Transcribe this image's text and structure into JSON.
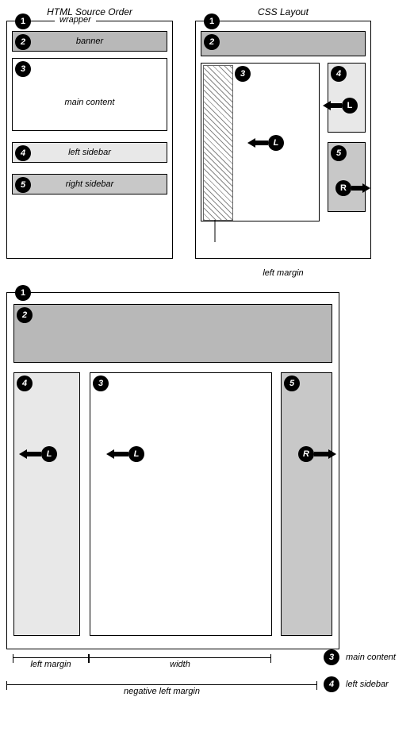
{
  "titles": {
    "html_source": "HTML Source Order",
    "css_layout": "CSS Layout"
  },
  "badges": {
    "n1": "1",
    "n2": "2",
    "n3": "3",
    "n4": "4",
    "n5": "5",
    "L": "L",
    "R": "R"
  },
  "labels": {
    "wrapper": "wrapper",
    "banner": "banner",
    "main_content": "main content",
    "left_sidebar": "left sidebar",
    "right_sidebar": "right sidebar",
    "left_margin": "left margin",
    "width": "width",
    "negative_left_margin": "negative left margin"
  },
  "trail": {
    "row1": {
      "badge": "3",
      "label": "main content"
    },
    "row2": {
      "badge": "4",
      "label": "left sidebar"
    }
  },
  "diagram": {
    "description": "Three-column CSS float layout using negative margins. Source order places main content before sidebars; CSS floats left sidebar (L=float:left with negative left margin) and right sidebar (R=float:right) beside a left-floated main column that reserves space via left margin.",
    "elements": [
      {
        "id": 1,
        "name": "wrapper"
      },
      {
        "id": 2,
        "name": "banner"
      },
      {
        "id": 3,
        "name": "main content",
        "float": "left"
      },
      {
        "id": 4,
        "name": "left sidebar",
        "float": "left",
        "uses_negative_left_margin": true
      },
      {
        "id": 5,
        "name": "right sidebar",
        "float": "right"
      }
    ],
    "arrows": {
      "L": "float: left",
      "R": "float: right"
    },
    "dimensions": {
      "main_content": [
        "left margin",
        "width"
      ],
      "left_sidebar": [
        "negative left margin"
      ]
    }
  }
}
